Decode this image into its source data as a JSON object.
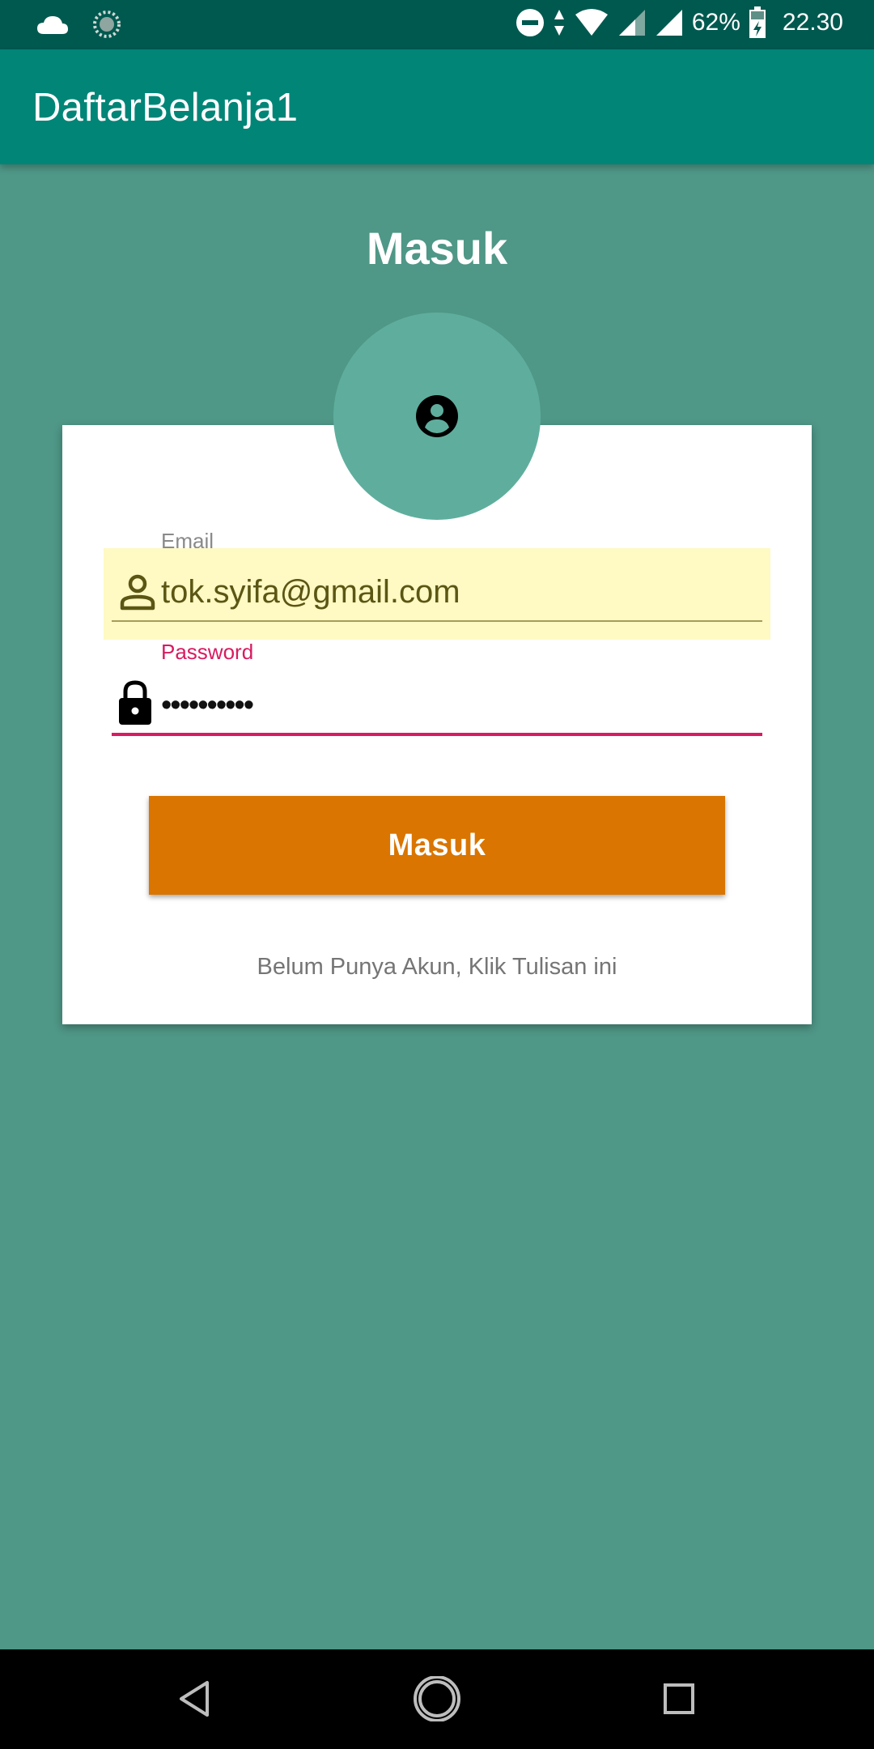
{
  "status_bar": {
    "battery_percent": "62%",
    "time": "22.30",
    "icons": [
      "cloud-icon",
      "sync-icon",
      "do-not-disturb-icon",
      "data-arrows-icon",
      "wifi-icon",
      "signal-icon",
      "signal-icon",
      "battery-charging-icon"
    ]
  },
  "app_bar": {
    "title": "DaftarBelanja1"
  },
  "page": {
    "title": "Masuk"
  },
  "form": {
    "avatar_icon": "account-circle-icon",
    "email": {
      "label": "Email",
      "value": "tok.syifa@gmail.com",
      "icon": "person-icon"
    },
    "password": {
      "label": "Password",
      "value": "••••••••••",
      "icon": "lock-icon"
    },
    "login_button_label": "Masuk",
    "register_link_text": "Belum Punya Akun, Klik Tulisan ini"
  },
  "nav_bar": {
    "buttons": [
      "back-icon",
      "home-icon",
      "recents-icon"
    ]
  },
  "colors": {
    "background": "#4f9787",
    "app_bar": "#008577",
    "status_bar": "#00594f",
    "button": "#d97500",
    "accent": "#d81b60",
    "autofill": "#fff9c4"
  }
}
